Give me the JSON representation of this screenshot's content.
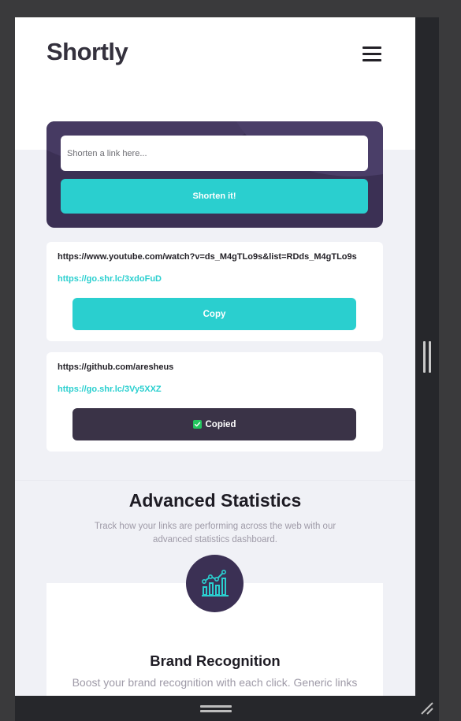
{
  "app": {
    "logo": "Shortly",
    "menu_icon": "hamburger-menu-icon"
  },
  "shorten": {
    "placeholder": "Shorten a link here...",
    "value": "",
    "button_label": "Shorten it!"
  },
  "links": [
    {
      "original": "https://www.youtube.com/watch?v=ds_M4gTLo9s&list=RDds_M4gTLo9s",
      "short": "https://go.shr.lc/3xdoFuD",
      "button_label": "Copy",
      "copied": false
    },
    {
      "original": "https://github.com/aresheus",
      "short": "https://go.shr.lc/3Vy5XXZ",
      "button_label": "Copied",
      "copied": true
    }
  ],
  "stats": {
    "title": "Advanced Statistics",
    "description": "Track how your links are performing across the web with our advanced statistics dashboard."
  },
  "feature": {
    "icon": "brand-recognition-chart-icon",
    "title": "Brand Recognition",
    "description": "Boost your brand recognition with each click. Generic links"
  },
  "colors": {
    "accent": "#2acfcf",
    "dark_violet": "#3b3054",
    "copied_button": "#3a3347",
    "check_green": "#22c55e"
  }
}
